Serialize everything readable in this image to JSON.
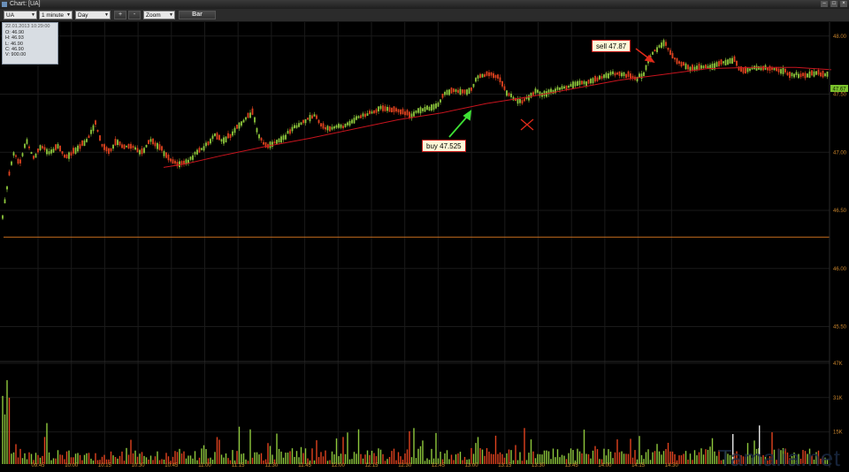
{
  "window": {
    "title": "Chart: [UA]"
  },
  "toolbar": {
    "symbol": "UA",
    "interval": "1 minute",
    "period": "Day",
    "zoom_in": "+",
    "zoom_out": "-",
    "zoom": "Zoom",
    "chart_style": "Bar"
  },
  "ohlc_box": {
    "datetime": "22.01.2013 10:29:00",
    "open": "O: 46.90",
    "high": "H: 46.93",
    "low": "L: 46.90",
    "close": "C: 46.90",
    "volume": "V: 900.00"
  },
  "annotations": {
    "buy": "buy 47.525",
    "sell": "sell 47.87"
  },
  "last_price_badge": "47.67",
  "watermark": "Tamalia.net",
  "colors": {
    "up": "#8ec83c",
    "down": "#e0421e",
    "ma": "#c8141e",
    "hline": "#c86e1e",
    "grid": "#1a1a1a"
  },
  "chart_data": {
    "type": "candlestick",
    "price_axis": {
      "ticks": [
        45.5,
        46.0,
        46.5,
        47.0,
        47.5,
        48.0
      ],
      "tick_labels": [
        "45.50",
        "46.00",
        "46.50",
        "47.00",
        "47.50",
        "48.00"
      ],
      "range": [
        45.2,
        48.12
      ]
    },
    "volume_axis": {
      "ticks": [
        15000,
        31000,
        47000
      ],
      "tick_labels": [
        "15K",
        "31K",
        "47K"
      ],
      "range": [
        0,
        47000
      ]
    },
    "time_labels": [
      "09:45",
      "10:00",
      "10:15",
      "10:30",
      "10:45",
      "11:00",
      "11:15",
      "11:30",
      "11:45",
      "12:00",
      "12:15",
      "12:30",
      "12:45",
      "13:00",
      "13:15",
      "13:30",
      "13:45",
      "14:00",
      "14:15",
      "14:30"
    ],
    "horizontal_line": 46.27,
    "price_path": [
      [
        0,
        45.4
      ],
      [
        2,
        46.4
      ],
      [
        6,
        46.6
      ],
      [
        10,
        46.8
      ],
      [
        16,
        47.0
      ],
      [
        22,
        46.9
      ],
      [
        30,
        47.1
      ],
      [
        38,
        46.95
      ],
      [
        46,
        47.05
      ],
      [
        56,
        47.0
      ],
      [
        66,
        47.05
      ],
      [
        74,
        46.95
      ],
      [
        82,
        47.0
      ],
      [
        90,
        47.05
      ],
      [
        98,
        47.1
      ],
      [
        108,
        47.25
      ],
      [
        116,
        47.05
      ],
      [
        124,
        47.0
      ],
      [
        132,
        47.1
      ],
      [
        140,
        47.05
      ],
      [
        150,
        47.05
      ],
      [
        160,
        47.0
      ],
      [
        170,
        47.1
      ],
      [
        180,
        47.05
      ],
      [
        190,
        46.95
      ],
      [
        200,
        46.9
      ],
      [
        212,
        46.92
      ],
      [
        222,
        47.0
      ],
      [
        232,
        47.05
      ],
      [
        242,
        47.15
      ],
      [
        252,
        47.1
      ],
      [
        262,
        47.15
      ],
      [
        272,
        47.25
      ],
      [
        280,
        47.3
      ],
      [
        286,
        47.35
      ],
      [
        292,
        47.15
      ],
      [
        300,
        47.05
      ],
      [
        310,
        47.08
      ],
      [
        320,
        47.12
      ],
      [
        330,
        47.2
      ],
      [
        340,
        47.25
      ],
      [
        350,
        47.3
      ],
      [
        356,
        47.32
      ],
      [
        364,
        47.22
      ],
      [
        372,
        47.2
      ],
      [
        380,
        47.22
      ],
      [
        388,
        47.22
      ],
      [
        396,
        47.26
      ],
      [
        404,
        47.3
      ],
      [
        412,
        47.32
      ],
      [
        422,
        47.35
      ],
      [
        430,
        47.38
      ],
      [
        440,
        47.37
      ],
      [
        452,
        47.35
      ],
      [
        464,
        47.32
      ],
      [
        474,
        47.36
      ],
      [
        484,
        47.38
      ],
      [
        494,
        47.4
      ],
      [
        504,
        47.52
      ],
      [
        516,
        47.53
      ],
      [
        526,
        47.52
      ],
      [
        534,
        47.55
      ],
      [
        540,
        47.65
      ],
      [
        550,
        47.67
      ],
      [
        560,
        47.66
      ],
      [
        566,
        47.62
      ],
      [
        574,
        47.5
      ],
      [
        582,
        47.46
      ],
      [
        590,
        47.44
      ],
      [
        598,
        47.48
      ],
      [
        606,
        47.53
      ],
      [
        614,
        47.5
      ],
      [
        622,
        47.52
      ],
      [
        632,
        47.55
      ],
      [
        642,
        47.56
      ],
      [
        652,
        47.6
      ],
      [
        662,
        47.6
      ],
      [
        672,
        47.62
      ],
      [
        682,
        47.65
      ],
      [
        692,
        47.68
      ],
      [
        702,
        47.67
      ],
      [
        712,
        47.66
      ],
      [
        720,
        47.64
      ],
      [
        728,
        47.68
      ],
      [
        734,
        47.8
      ],
      [
        740,
        47.87
      ],
      [
        746,
        47.92
      ],
      [
        752,
        47.95
      ],
      [
        758,
        47.85
      ],
      [
        766,
        47.78
      ],
      [
        774,
        47.75
      ],
      [
        782,
        47.72
      ],
      [
        792,
        47.74
      ],
      [
        802,
        47.73
      ],
      [
        812,
        47.76
      ],
      [
        822,
        47.78
      ],
      [
        830,
        47.8
      ],
      [
        836,
        47.72
      ],
      [
        842,
        47.7
      ],
      [
        850,
        47.72
      ],
      [
        860,
        47.73
      ],
      [
        870,
        47.72
      ],
      [
        880,
        47.71
      ],
      [
        888,
        47.7
      ],
      [
        892,
        47.66
      ],
      [
        900,
        47.67
      ],
      [
        910,
        47.66
      ],
      [
        920,
        47.68
      ],
      [
        930,
        47.67
      ],
      [
        938,
        47.67
      ]
    ],
    "ma_path": [
      [
        185,
        46.87
      ],
      [
        210,
        46.9
      ],
      [
        250,
        46.97
      ],
      [
        300,
        47.05
      ],
      [
        350,
        47.12
      ],
      [
        400,
        47.2
      ],
      [
        450,
        47.28
      ],
      [
        500,
        47.34
      ],
      [
        550,
        47.42
      ],
      [
        600,
        47.48
      ],
      [
        650,
        47.55
      ],
      [
        700,
        47.62
      ],
      [
        750,
        47.67
      ],
      [
        800,
        47.72
      ],
      [
        850,
        47.73
      ],
      [
        900,
        47.73
      ],
      [
        940,
        47.71
      ]
    ]
  }
}
